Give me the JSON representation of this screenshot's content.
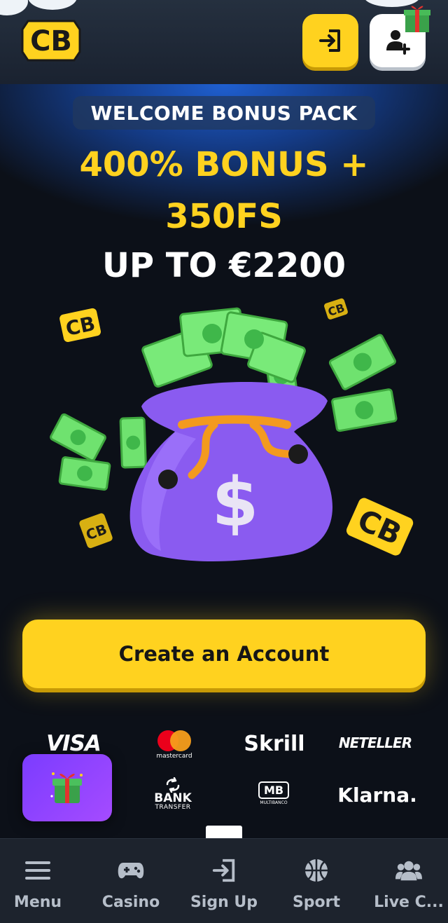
{
  "header": {
    "logo_text": "CB",
    "login_icon": "sign-in-icon",
    "signup_icon": "user-plus-icon"
  },
  "hero": {
    "pill": "WELCOME BONUS PACK",
    "line1": "400% BONUS +",
    "line2": "350FS",
    "line3": "UP TO €2200",
    "illustration": "money-bag-with-cash"
  },
  "cta": {
    "label": "Create an Account"
  },
  "payments": {
    "visa": "VISA",
    "mastercard": "mastercard",
    "skrill": "Skrill",
    "neteller": "NETELLER",
    "bank_line1": "BANK",
    "bank_line2": "TRANSFER",
    "mb": "MB",
    "mb_sub": "MULTIBANCO",
    "klarna": "Klarna."
  },
  "nav": {
    "items": [
      {
        "label": "Menu",
        "icon": "hamburger-icon"
      },
      {
        "label": "Casino",
        "icon": "gamepad-icon"
      },
      {
        "label": "Sign Up",
        "icon": "sign-in-icon"
      },
      {
        "label": "Sport",
        "icon": "basketball-icon"
      },
      {
        "label": "Live C...",
        "icon": "users-icon"
      }
    ]
  },
  "colors": {
    "accent": "#ffd21f",
    "background": "#0c1018",
    "nav_bg": "#1d232d",
    "promo": "#8f45ff"
  }
}
